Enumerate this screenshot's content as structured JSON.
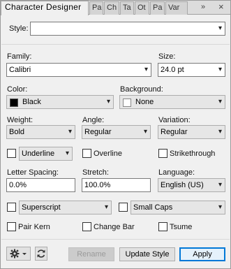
{
  "tabs": {
    "active": "Character Designer",
    "others": [
      "Pa",
      "Ch",
      "Ta",
      "Ot",
      "Pa",
      "Var"
    ],
    "overflow_glyph": "»",
    "close_glyph": "×"
  },
  "style": {
    "label": "Style:",
    "value": ""
  },
  "family": {
    "label": "Family:",
    "value": "Calibri"
  },
  "size": {
    "label": "Size:",
    "value": "24.0 pt"
  },
  "color": {
    "label": "Color:",
    "value": "Black",
    "swatch": "#000000"
  },
  "background": {
    "label": "Background:",
    "value": "None",
    "swatch": "#ffffff"
  },
  "weight": {
    "label": "Weight:",
    "value": "Bold"
  },
  "angle": {
    "label": "Angle:",
    "value": "Regular"
  },
  "variation": {
    "label": "Variation:",
    "value": "Regular"
  },
  "underline": {
    "value": "Underline",
    "checked": false
  },
  "overline": {
    "label": "Overline",
    "checked": false
  },
  "strikethrough": {
    "label": "Strikethrough",
    "checked": false
  },
  "letter_spacing": {
    "label": "Letter Spacing:",
    "value": "0.0%"
  },
  "stretch": {
    "label": "Stretch:",
    "value": "100.0%"
  },
  "language": {
    "label": "Language:",
    "value": "English (US)"
  },
  "superscript": {
    "value": "Superscript",
    "checked": false
  },
  "small_caps": {
    "value": "Small Caps",
    "checked": false
  },
  "pair_kern": {
    "label": "Pair Kern",
    "checked": false
  },
  "change_bar": {
    "label": "Change Bar",
    "checked": false
  },
  "tsume": {
    "label": "Tsume",
    "checked": false
  },
  "buttons": {
    "rename": "Rename",
    "update_style": "Update Style",
    "apply": "Apply"
  },
  "icons": {
    "gear": "gear-icon",
    "refresh": "refresh-icon",
    "arrow": "▾"
  },
  "colors": {
    "accent": "#0078d7",
    "panel_bg": "#f0f0f0"
  }
}
